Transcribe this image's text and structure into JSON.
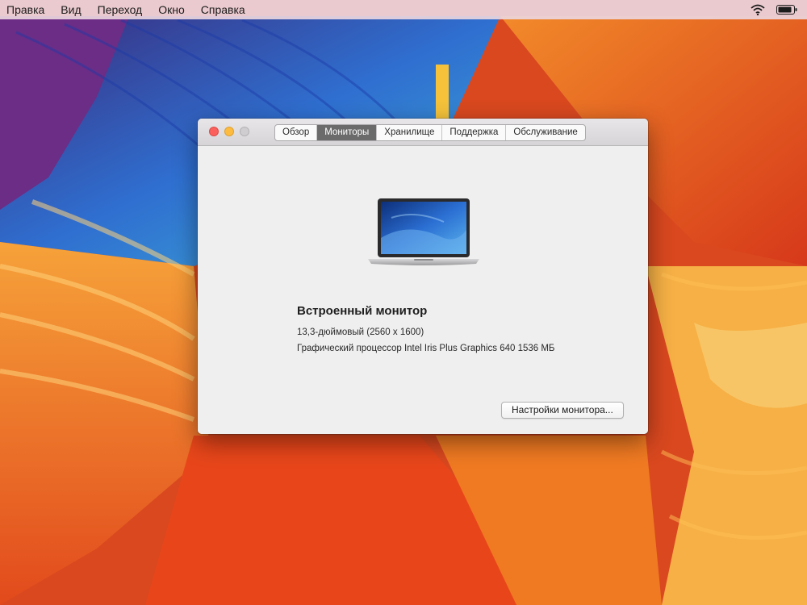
{
  "menubar": {
    "items": [
      "Правка",
      "Вид",
      "Переход",
      "Окно",
      "Справка"
    ],
    "status_icons": [
      "wifi-icon",
      "battery-icon"
    ]
  },
  "window": {
    "tabs": [
      {
        "label": "Обзор",
        "active": false
      },
      {
        "label": "Мониторы",
        "active": true
      },
      {
        "label": "Хранилище",
        "active": false
      },
      {
        "label": "Поддержка",
        "active": false
      },
      {
        "label": "Обслуживание",
        "active": false
      }
    ],
    "display": {
      "name": "Встроенный монитор",
      "size": "13,3-дюймовый (2560 x 1600)",
      "gpu": "Графический процессор Intel Iris Plus Graphics 640 1536 МБ"
    },
    "settings_button": "Настройки монитора..."
  },
  "colors": {
    "close": "#fc605c",
    "minimize": "#fdbc40",
    "zoom": "#cfcdcf",
    "active_tab": "#6c6b6c"
  }
}
